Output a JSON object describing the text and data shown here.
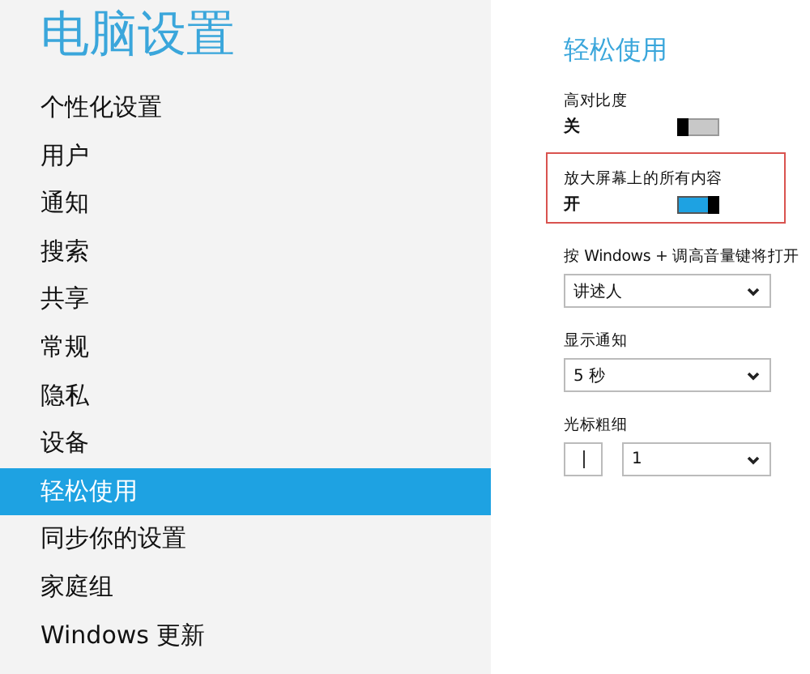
{
  "sidebar": {
    "title": "电脑设置",
    "items": [
      {
        "label": "个性化设置",
        "selected": false
      },
      {
        "label": "用户",
        "selected": false
      },
      {
        "label": "通知",
        "selected": false
      },
      {
        "label": "搜索",
        "selected": false
      },
      {
        "label": "共享",
        "selected": false
      },
      {
        "label": "常规",
        "selected": false
      },
      {
        "label": "隐私",
        "selected": false
      },
      {
        "label": "设备",
        "selected": false
      },
      {
        "label": "轻松使用",
        "selected": true
      },
      {
        "label": "同步你的设置",
        "selected": false
      },
      {
        "label": "家庭组",
        "selected": false
      },
      {
        "label": "Windows 更新",
        "selected": false
      }
    ]
  },
  "content": {
    "heading": "轻松使用",
    "settings": [
      {
        "kind": "toggle",
        "label": "高对比度",
        "state_text": "关",
        "on": false,
        "highlighted": false
      },
      {
        "kind": "toggle",
        "label": "放大屏幕上的所有内容",
        "state_text": "开",
        "on": true,
        "highlighted": true
      },
      {
        "kind": "dropdown",
        "label": "按 Windows + 调高音量键将打开",
        "value": "讲述人"
      },
      {
        "kind": "dropdown",
        "label": "显示通知",
        "value": "5 秒"
      },
      {
        "kind": "cursor",
        "label": "光标粗细",
        "value": "1"
      }
    ]
  }
}
